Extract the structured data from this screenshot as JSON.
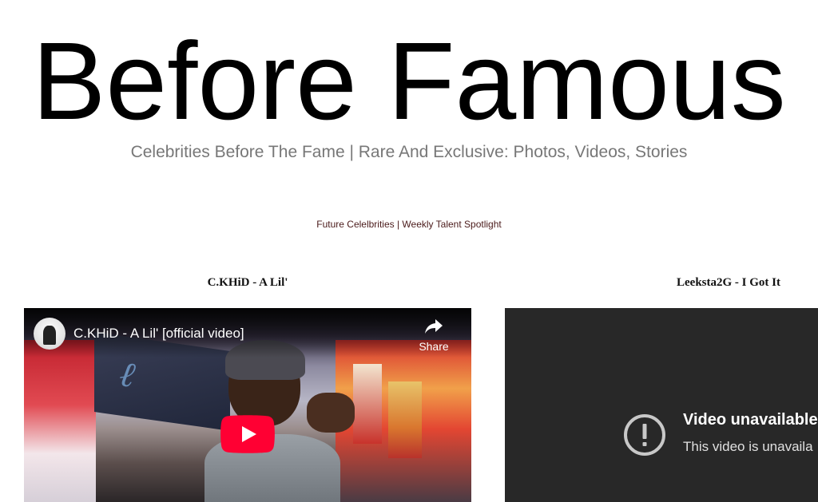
{
  "header": {
    "site_title": "Before Famous",
    "tagline": "Celebrities Before The Fame | Rare And Exclusive: Photos, Videos, Stories"
  },
  "spotlight": {
    "link_text": "Future Celelbrities | Weekly Talent Spotlight"
  },
  "videos": [
    {
      "heading": "C.KHiD - A Lil'",
      "player_title": "C.KHiD - A Lil' [official video]",
      "share_label": "Share",
      "play_icon": "play-icon"
    },
    {
      "heading": "Leeksta2G - I Got It",
      "unavailable_title": "Video unavailable",
      "unavailable_message": "This video is unavaila",
      "icon": "exclamation-circle-icon"
    }
  ],
  "colors": {
    "tagline": "#777777",
    "spotlight_link": "#4a1a1a",
    "play_button": "#ff0000",
    "unavailable_bg": "#282828"
  }
}
